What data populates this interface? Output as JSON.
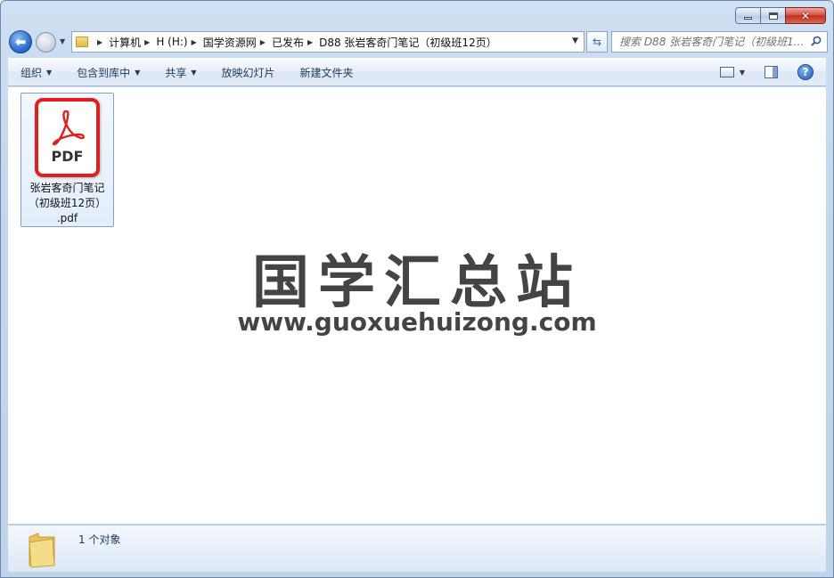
{
  "address": {
    "crumbs": [
      "计算机",
      "H (H:)",
      "国学资源网",
      "已发布",
      "D88 张岩客奇门笔记（初级班12页）"
    ]
  },
  "search": {
    "placeholder": "搜索 D88 张岩客奇门笔记（初级班1..."
  },
  "toolbar": {
    "organize_label": "组织",
    "include_library_label": "包含到库中",
    "share_label": "共享",
    "slideshow_label": "放映幻灯片",
    "new_folder_label": "新建文件夹"
  },
  "icons": {
    "back": "back-arrow-icon",
    "forward": "forward-arrow-icon",
    "refresh": "refresh-icon",
    "search": "search-icon",
    "view": "view-options-icon",
    "preview_pane": "preview-pane-icon",
    "help": "help-icon",
    "file": "pdf-file-icon",
    "status": "folder-icon"
  },
  "files": [
    {
      "name_line1": "张岩客奇门笔记",
      "name_line2": "（初级班12页）",
      "name_line3": ".pdf",
      "icon_label": "PDF"
    }
  ],
  "watermark": {
    "title": "国学汇总站",
    "url": "www.guoxuehuizong.com"
  },
  "status": {
    "count_text": "1 个对象"
  },
  "colors": {
    "pdf_red": "#e02020",
    "accent_blue": "#2a6fcf",
    "toolbar_text": "#1e395b"
  }
}
